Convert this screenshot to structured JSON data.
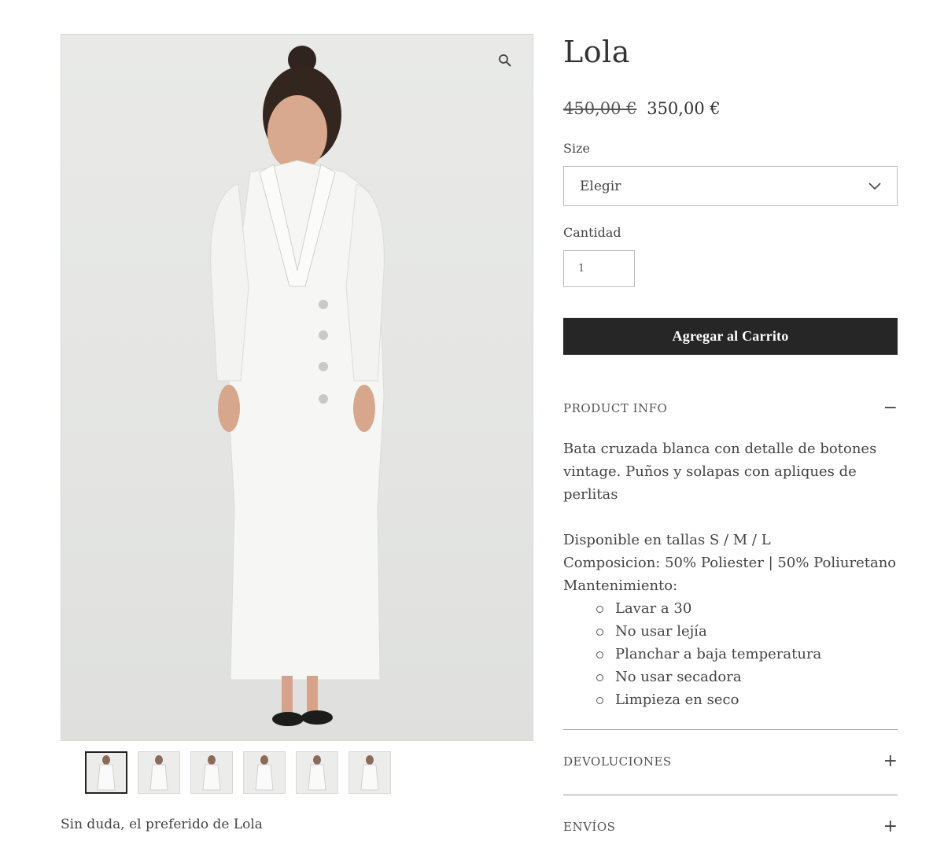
{
  "gallery": {
    "zoom_icon": "magnifier-icon",
    "thumbnails": [
      "thumb-1",
      "thumb-2",
      "thumb-3",
      "thumb-4",
      "thumb-5",
      "thumb-6"
    ],
    "active_thumbnail": 0,
    "caption": "Sin duda, el preferido de Lola"
  },
  "product": {
    "title": "Lola",
    "price_old": "450,00 €",
    "price_new": "350,00 €",
    "size_label": "Size",
    "size_select_value": "Elegir",
    "quantity_label": "Cantidad",
    "quantity_value": "1",
    "add_to_cart_label": "Agregar al Carrito"
  },
  "accordion": {
    "product_info": {
      "title": "PRODUCT INFO",
      "sign": "−",
      "description": "Bata cruzada blanca con detalle de botones vintage. Puños y solapas con apliques de perlitas",
      "sizes": "Disponible en tallas S / M / L",
      "composition": "Composicion: 50% Poliester | 50% Poliuretano",
      "maintenance_label": "Mantenimiento:",
      "care": [
        "Lavar a 30",
        "No usar lejía",
        "Planchar a baja temperatura",
        "No usar secadora",
        "Limpieza en seco"
      ]
    },
    "returns": {
      "title": "DEVOLUCIONES",
      "sign": "+"
    },
    "shipping": {
      "title": "ENVÍOS",
      "sign": "+"
    }
  },
  "colors": {
    "button_bg": "#262626",
    "image_bg": "#e6e7e5"
  }
}
